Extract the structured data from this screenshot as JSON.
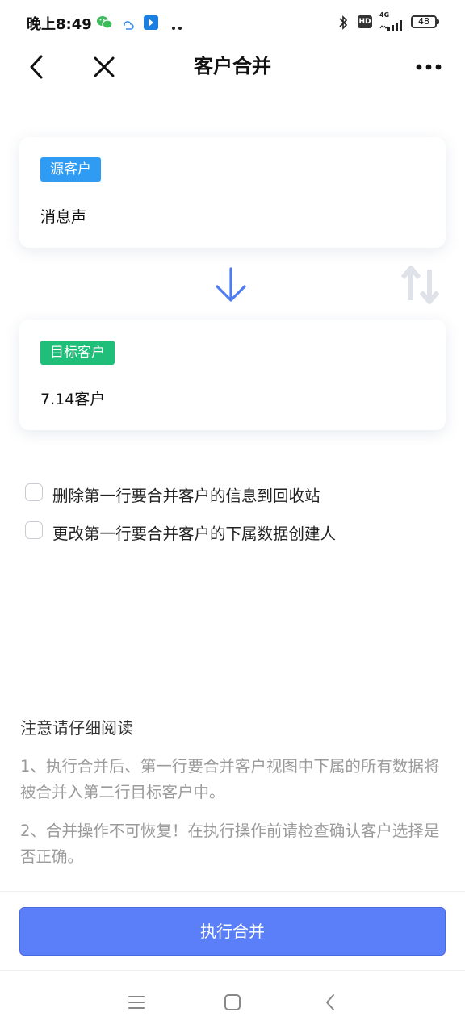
{
  "status_bar": {
    "time": "晚上8:49",
    "network": "4G",
    "hd_label": "HD",
    "battery": "48"
  },
  "nav": {
    "title": "客户合并"
  },
  "source": {
    "tag": "源客户",
    "tag_color": "#2f9bf2",
    "value": "消息声"
  },
  "target": {
    "tag": "目标客户",
    "tag_color": "#1fbe79",
    "value": "7.14客户"
  },
  "icons": {
    "merge_arrow": "arrow-down-icon",
    "swap": "swap-vertical-icon"
  },
  "options": [
    {
      "label": "删除第一行要合并客户的信息到回收站",
      "checked": false
    },
    {
      "label": "更改第一行要合并客户的下属数据创建人",
      "checked": false
    }
  ],
  "notice": {
    "title": "注意请仔细阅读",
    "items": [
      "1、执行合并后、第一行要合并客户视图中下属的所有数据将被合并入第二行目标客户中。",
      "2、合并操作不可恢复！在执行操作前请检查确认客户选择是否正确。"
    ]
  },
  "actions": {
    "merge_button": "执行合并"
  },
  "colors": {
    "accent": "#5b7ff8",
    "arrow": "#4f7df0"
  }
}
